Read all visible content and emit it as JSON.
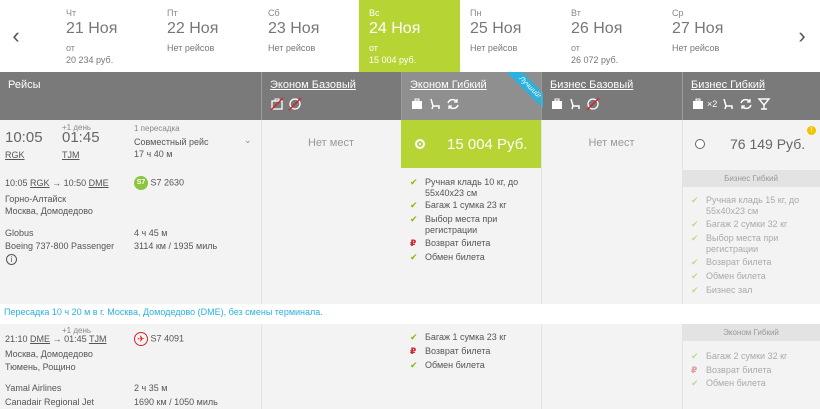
{
  "dates": [
    {
      "dow": "Чт",
      "date": "21 Ноя",
      "from": "от",
      "price": "20 234 руб."
    },
    {
      "dow": "Пт",
      "date": "22 Ноя",
      "from": "",
      "price": "Нет рейсов"
    },
    {
      "dow": "Сб",
      "date": "23 Ноя",
      "from": "",
      "price": "Нет рейсов"
    },
    {
      "dow": "Вс",
      "date": "24 Ноя",
      "from": "от",
      "price": "15 004 руб."
    },
    {
      "dow": "Пн",
      "date": "25 Ноя",
      "from": "",
      "price": "Нет рейсов"
    },
    {
      "dow": "Вт",
      "date": "26 Ноя",
      "from": "от",
      "price": "26 072 руб."
    },
    {
      "dow": "Ср",
      "date": "27 Ноя",
      "from": "",
      "price": "Нет рейсов"
    }
  ],
  "header": {
    "flights": "Рейсы",
    "econ_basic": "Эконом Базовый",
    "econ_flex": "Эконом Гибкий",
    "best_badge": "Лучший!",
    "biz_basic": "Бизнес Базовый",
    "biz_flex": "Бизнес Гибкий",
    "biz_flex_x2": "×2"
  },
  "flight1": {
    "dep_time": "10:05",
    "arr_plus": "+1 день",
    "arr_time": "01:45",
    "dep_code": "RGK",
    "arr_code": "TJM",
    "transfers": "1 пересадка",
    "joint": "Совместный рейс",
    "duration": "17 ч 40 м",
    "segment_route_time1": "10:05",
    "segment_from": "RGK",
    "segment_arrow": "→",
    "segment_route_time2": "10:50",
    "segment_to": "DME",
    "segment_flight": "S7 2630",
    "segment_city1": "Горно-Алтайск",
    "segment_city2": "Москва, Домодедово",
    "segment_airline": "Globus",
    "segment_aircraft": "Boeing 737-800 Passenger",
    "segment_duration": "4 ч 45 м",
    "segment_distance": "3114 км / 1935 миль"
  },
  "fares1": {
    "no_seats": "Нет мест",
    "flex_price": "15 004 Руб.",
    "biz_price": "76 149 Руб.",
    "econ_features": [
      {
        "icon": "check",
        "text": "Ручная кладь 10 кг, до"
      },
      {
        "icon": "",
        "text": "55x40x23 см"
      },
      {
        "icon": "check",
        "text": "Багаж 1 сумка 23 кг"
      },
      {
        "icon": "check",
        "text": "Выбор места при"
      },
      {
        "icon": "",
        "text": "регистрации"
      },
      {
        "icon": "rub",
        "text": "Возврат билета"
      },
      {
        "icon": "check",
        "text": "Обмен билета"
      }
    ],
    "biz_sub": "Бизнес Гибкий",
    "biz_features": [
      {
        "icon": "check",
        "text": "Ручная кладь 15 кг, до"
      },
      {
        "icon": "",
        "text": "55x40x23 см"
      },
      {
        "icon": "check",
        "text": "Багаж 2 сумки 32 кг"
      },
      {
        "icon": "check",
        "text": "Выбор места при"
      },
      {
        "icon": "",
        "text": "регистрации"
      },
      {
        "icon": "check",
        "text": "Возврат билета"
      },
      {
        "icon": "check",
        "text": "Обмен билета"
      },
      {
        "icon": "check",
        "text": "Бизнес зал"
      }
    ]
  },
  "transfer_note": "Пересадка 10 ч 20 м в г. Москва, Домодедово (DME), без смены терминала.",
  "flight2": {
    "dep_time": "21:10",
    "dep_code": "DME",
    "arrow": "→",
    "arr_plus": "+1 день",
    "arr_time": "01:45",
    "arr_code": "TJM",
    "flight": "S7 4091",
    "city1": "Москва, Домодедово",
    "city2": "Тюмень, Рощино",
    "airline": "Yamal Airlines",
    "aircraft": "Canadair Regional Jet",
    "duration": "2 ч 35 м",
    "distance": "1690 км / 1050 миль"
  },
  "fares2": {
    "econ_features": [
      {
        "icon": "check",
        "text": "Багаж 1 сумка 23 кг"
      },
      {
        "icon": "rub",
        "text": "Возврат билета"
      },
      {
        "icon": "check",
        "text": "Обмен билета"
      }
    ],
    "biz_sub": "Эконом Гибкий",
    "biz_features": [
      {
        "icon": "check",
        "text": "Багаж 2 сумки 32 кг"
      },
      {
        "icon": "rub",
        "text": "Возврат билета"
      },
      {
        "icon": "check",
        "text": "Обмен билета"
      }
    ]
  },
  "colors": {
    "accent": "#b6d433",
    "header": "#7a7a7a",
    "link": "#2ab1de",
    "check": "#8cb80a",
    "rub": "#d2232a"
  }
}
